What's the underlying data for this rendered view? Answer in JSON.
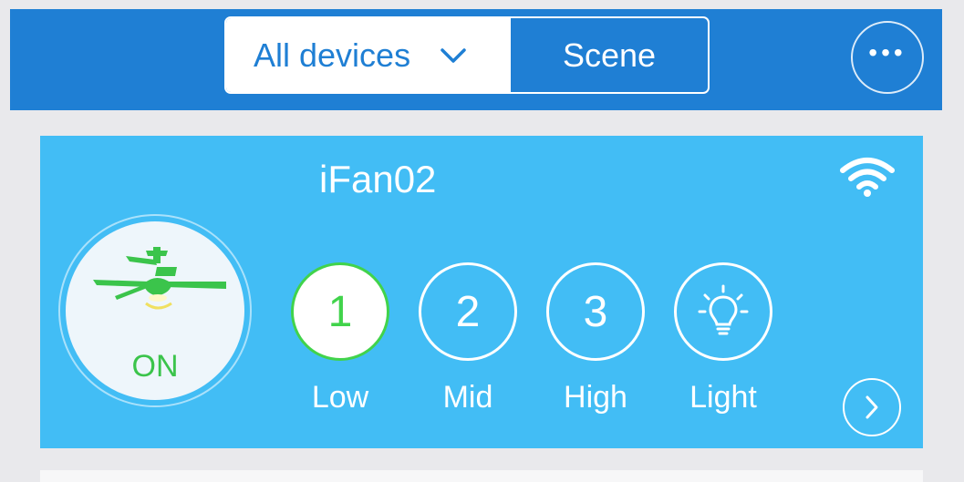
{
  "header": {
    "device_filter": {
      "selected": "All devices"
    },
    "scene_label": "Scene",
    "more_icon": "more-options-icon"
  },
  "device_card": {
    "name": "iFan02",
    "signal_icon": "wifi-icon",
    "power": {
      "state": "ON",
      "icon": "ceiling-fan-icon"
    },
    "speeds": [
      {
        "value": "1",
        "label": "Low",
        "active": true
      },
      {
        "value": "2",
        "label": "Mid",
        "active": false
      },
      {
        "value": "3",
        "label": "High",
        "active": false
      }
    ],
    "light": {
      "label": "Light",
      "icon": "light-bulb-icon"
    },
    "next_icon": "chevron-right-icon"
  },
  "colors": {
    "header_blue": "#1f7fd4",
    "card_blue": "#42bdf5",
    "active_green": "#41d34b",
    "background": "#e9e9ec"
  }
}
